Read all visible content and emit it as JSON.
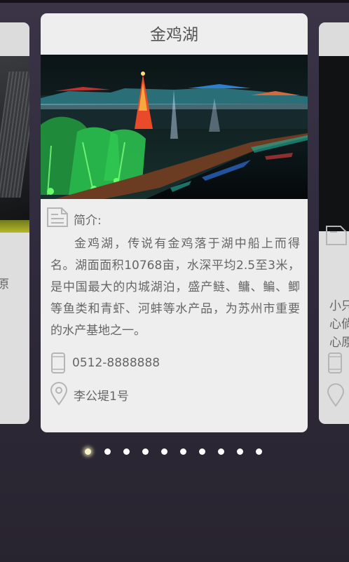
{
  "card": {
    "title": "金鸡湖",
    "intro_label": "简介:",
    "description": "金鸡湖，传说有金鸡落于湖中船上而得名。湖面面积10768亩，水深平均2.5至3米，是中国最大的内城湖泊，盛产鲢、鳙、鳊、鲫等鱼类和青虾、河蚌等水产品，为苏州市重要的水产基地之一。",
    "phone": "0512-8888888",
    "address": "李公堤1号",
    "icons": {
      "intro": "document-icon",
      "phone": "phone-icon",
      "address": "location-pin-icon"
    }
  },
  "left_card": {
    "text_fragment": "原\n."
  },
  "right_card": {
    "text_fragment": "小只\n心倘\n心原"
  },
  "pager": {
    "count": 10,
    "active_index": 0
  },
  "colors": {
    "accent_dot": "#f6f2c6",
    "card_bg": "#eeeeee",
    "text": "#666666"
  }
}
